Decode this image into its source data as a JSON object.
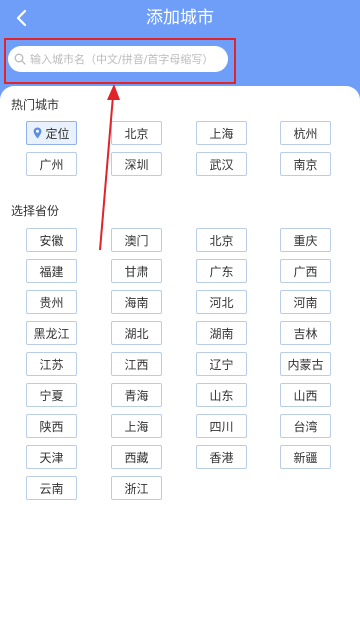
{
  "header": {
    "title": "添加城市",
    "back_icon": "chevron-left-icon"
  },
  "search": {
    "placeholder": "输入城市名（中文/拼音/首字母缩写）",
    "icon": "search-icon"
  },
  "hot": {
    "title": "热门城市",
    "cities": [
      "定位",
      "北京",
      "上海",
      "杭州",
      "广州",
      "深圳",
      "武汉",
      "南京"
    ]
  },
  "provinces": {
    "title": "选择省份",
    "items": [
      "安徽",
      "澳门",
      "北京",
      "重庆",
      "福建",
      "甘肃",
      "广东",
      "广西",
      "贵州",
      "海南",
      "河北",
      "河南",
      "黑龙江",
      "湖北",
      "湖南",
      "吉林",
      "江苏",
      "江西",
      "辽宁",
      "内蒙古",
      "宁夏",
      "青海",
      "山东",
      "山西",
      "陕西",
      "上海",
      "四川",
      "台湾",
      "天津",
      "西藏",
      "香港",
      "新疆",
      "云南",
      "浙江"
    ]
  },
  "colors": {
    "header": "#6f9ef8",
    "highlight": "#e0242a",
    "chip_border": "#b9cde6"
  }
}
